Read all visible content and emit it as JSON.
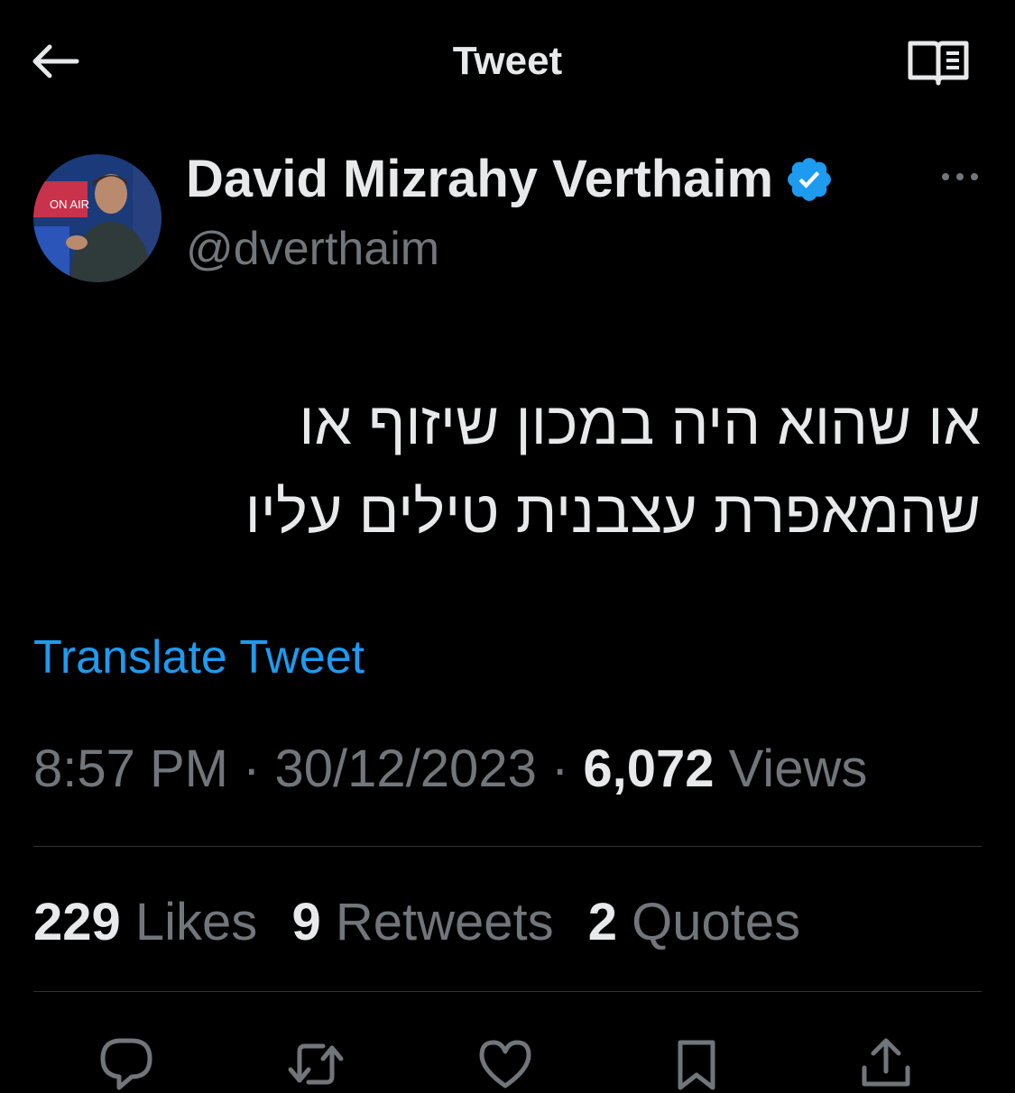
{
  "header": {
    "title": "Tweet",
    "back_icon": "arrow-left-icon",
    "reader_icon": "reader-mode-icon"
  },
  "author": {
    "name": "David Mizrahy Verthaim",
    "handle": "@dverthaim",
    "verified_color": "#1d9bf0",
    "avatar_text": "ON AIR"
  },
  "tweet": {
    "lines": [
      "או שהוא היה במכון שיזוף או",
      "שהמאפרת עצבנית טילים עליו"
    ],
    "translate_label": "Translate Tweet"
  },
  "meta": {
    "time": "8:57 PM",
    "sep1": " · ",
    "date": "30/12/2023",
    "sep2": " · ",
    "views_count": "6,072",
    "views_label": "Views"
  },
  "stats": {
    "likes_count": "229",
    "likes_label": "Likes",
    "retweets_count": "9",
    "retweets_label": "Retweets",
    "quotes_count": "2",
    "quotes_label": "Quotes"
  },
  "actions": [
    "reply-icon",
    "retweet-icon",
    "like-icon",
    "bookmark-icon",
    "share-icon"
  ],
  "colors": {
    "background": "#000000",
    "text": "#e7e9ea",
    "secondary": "#71767b",
    "accent": "#1d9bf0",
    "divider": "#2f3336"
  }
}
